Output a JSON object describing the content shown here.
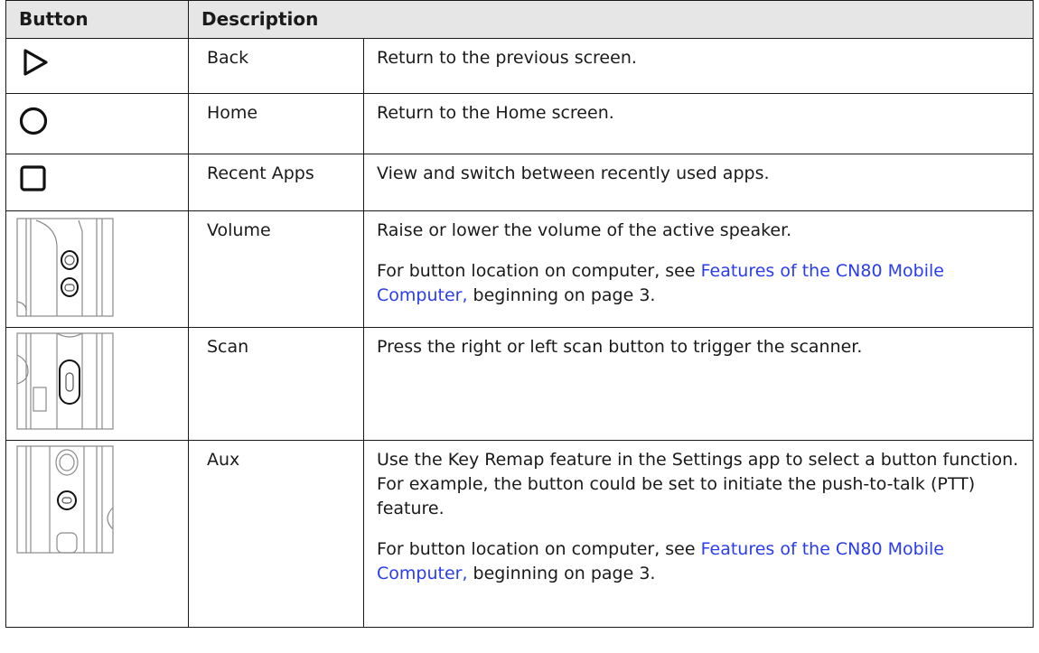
{
  "header": {
    "button": "Button",
    "description": "Description"
  },
  "rows": [
    {
      "icon": "back-triangle-icon",
      "label": "Back",
      "desc": [
        "Return to the previous screen."
      ]
    },
    {
      "icon": "home-circle-icon",
      "label": "Home",
      "desc": [
        "Return to the Home screen."
      ]
    },
    {
      "icon": "recent-apps-square-icon",
      "label": "Recent Apps",
      "desc": [
        "View and switch between recently used apps."
      ]
    },
    {
      "icon": "volume-button-icon",
      "label": "Volume",
      "desc": [
        "Raise or lower the volume of the active speaker."
      ],
      "note": {
        "pre": "For button location on computer, see ",
        "link": "Features of the CN80 Mobile Computer,",
        "post": " beginning on page 3."
      }
    },
    {
      "icon": "scan-button-icon",
      "label": "Scan",
      "desc": [
        "Press the right or left scan button to trigger the scanner."
      ]
    },
    {
      "icon": "aux-button-icon",
      "label": "Aux",
      "desc": [
        "Use the Key Remap feature in the Settings app to select a button function. For example, the button could be set to initiate the push-to-talk (PTT) feature."
      ],
      "note": {
        "pre": "For button location on computer, see ",
        "link": "Features of the CN80 Mobile Computer,",
        "post": " beginning on page 3."
      }
    }
  ],
  "colors": {
    "link": "#2a3cf0",
    "header_bg": "#e6e6e6",
    "border": "#1a1a1a"
  }
}
